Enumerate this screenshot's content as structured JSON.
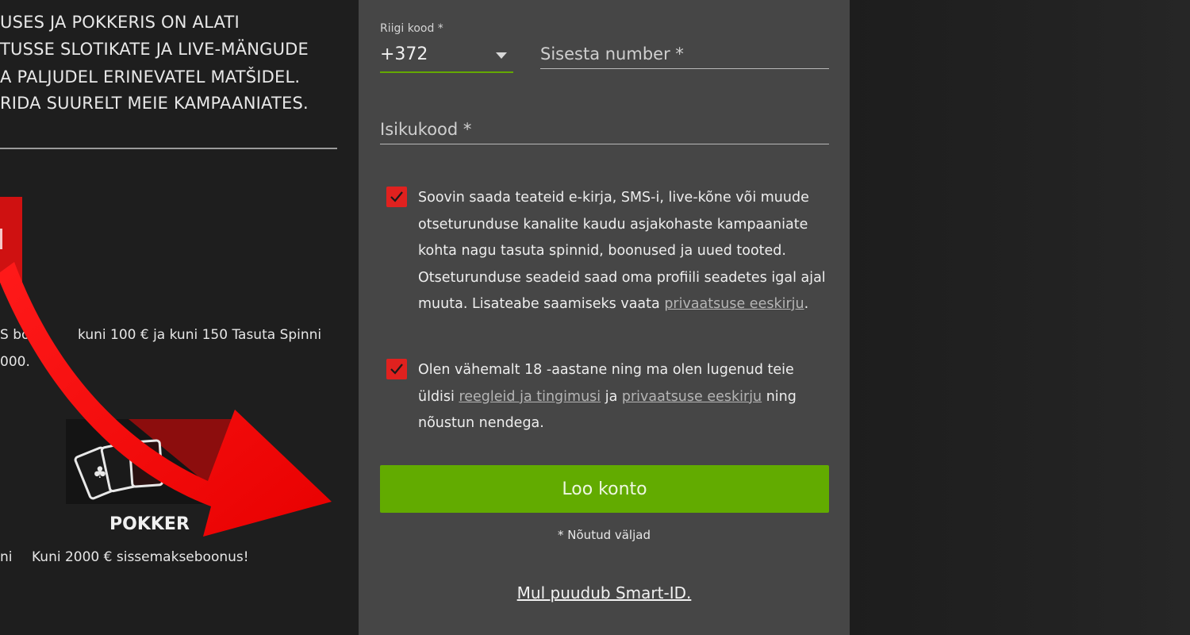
{
  "promo": {
    "lines": [
      "USES JA POKKERIS ON ALATI",
      "TUSSE SLOTIKATE JA LIVE-MÄNGUDE",
      "A PALJUDEL ERINEVATEL MATŠIDEL.",
      "RIDA SUURELT MEIE KAMPAANIATES."
    ],
    "bonus_line1_left": "S boon",
    "bonus_line1_right": "kuni 100 € ja kuni 150 Tasuta Spinni",
    "bonus_line2": "000.",
    "poker_label": "POKKER",
    "bottom_left_fragment": "ni",
    "bottom_bonus": "Kuni 2000 € sissemakseboonus!"
  },
  "form": {
    "country_code_label": "Riigi kood *",
    "country_code_value": "+372",
    "phone_placeholder": "Sisesta number *",
    "personal_code_placeholder": "Isikukood *",
    "consent_marketing": {
      "text": "Soovin saada teateid e-kirja, SMS-i, live-kõne või muude otseturunduse kanalite kaudu asjakohaste kampaaniate kohta nagu tasuta spinnid, boonused ja uued tooted. Otseturunduse seadeid saad oma profiili seadetes igal ajal muuta. Lisateabe saamiseks vaata ",
      "link": "privaatsuse eeskirju",
      "end": "."
    },
    "consent_terms": {
      "text1": "Olen vähemalt 18 -aastane ning ma olen lugenud teie üldisi ",
      "link1": "reegleid ja tingimusi",
      "text2": " ja ",
      "link2": "privaatsuse eeskirju",
      "text3": " ning nõustun nendega."
    },
    "submit_label": "Loo konto",
    "required_note": "* Nõutud väljad",
    "no_smartid_link": "Mul puudub Smart-ID."
  },
  "colors": {
    "accent_green": "#62ab00",
    "checkbox_red": "#e0211f",
    "panel_bg": "#464646",
    "page_bg": "#1f1f1f"
  }
}
